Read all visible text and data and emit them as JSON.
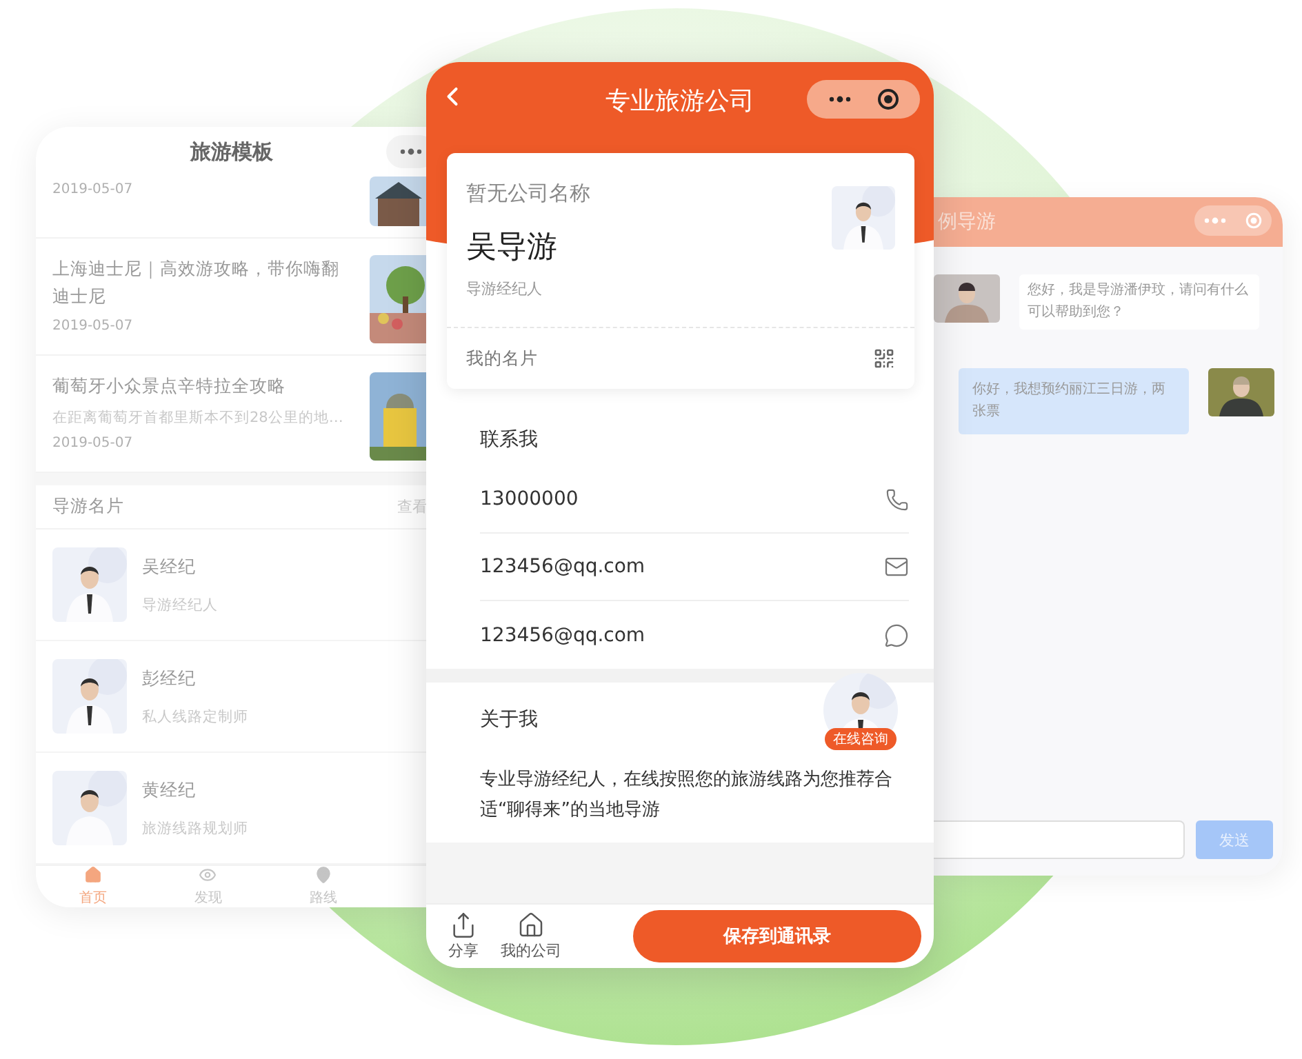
{
  "left_phone": {
    "title": "旅游模板",
    "articles": [
      {
        "date": "2019-05-07"
      },
      {
        "title": "上海迪士尼｜高效游攻略，带你嗨翻迪士尼",
        "date": "2019-05-07"
      },
      {
        "title": "葡萄牙小众景点辛特拉全攻略",
        "summary": "在距离葡萄牙首都里斯本不到28公里的地…",
        "date": "2019-05-07"
      }
    ],
    "guides_section": {
      "title": "导游名片",
      "more": "查看"
    },
    "guides": [
      {
        "name": "吴经纪",
        "role": "导游经纪人"
      },
      {
        "name": "彭经纪",
        "role": "私人线路定制师"
      },
      {
        "name": "黄经纪",
        "role": "旅游线路规划师"
      }
    ],
    "tabs": [
      {
        "kind": "home",
        "label": "首页",
        "selected": true
      },
      {
        "kind": "discover",
        "label": "发现",
        "selected": false
      },
      {
        "kind": "route",
        "label": "路线",
        "selected": false
      }
    ]
  },
  "center_phone": {
    "title": "专业旅游公司",
    "card": {
      "company": "暂无公司名称",
      "name": "吴导游",
      "role": "导游经纪人",
      "footer": "我的名片"
    },
    "contact": {
      "heading": "联系我",
      "items": [
        {
          "kind": "phone",
          "value": "13000000"
        },
        {
          "kind": "mail",
          "value": "123456@qq.com"
        },
        {
          "kind": "wechat",
          "value": "123456@qq.com"
        }
      ]
    },
    "consult_badge": "在线咨询",
    "about": {
      "heading": "关于我",
      "text": "专业导游经纪人，在线按照您的旅游线路为您推荐合适“聊得来”的当地导游"
    },
    "bottom_bar": {
      "actions": [
        {
          "kind": "share",
          "label": "分享"
        },
        {
          "kind": "home",
          "label": "我的公司"
        }
      ],
      "primary_button": "保存到通讯录"
    }
  },
  "right_phone": {
    "title": "例导游",
    "messages": [
      {
        "kind": "guide",
        "text": "您好，我是导游潘伊玟，请问有什么可以帮助到您？"
      },
      {
        "kind": "user",
        "text": "你好，我想预约丽江三日游，两张票"
      }
    ],
    "send_button": "发送"
  }
}
